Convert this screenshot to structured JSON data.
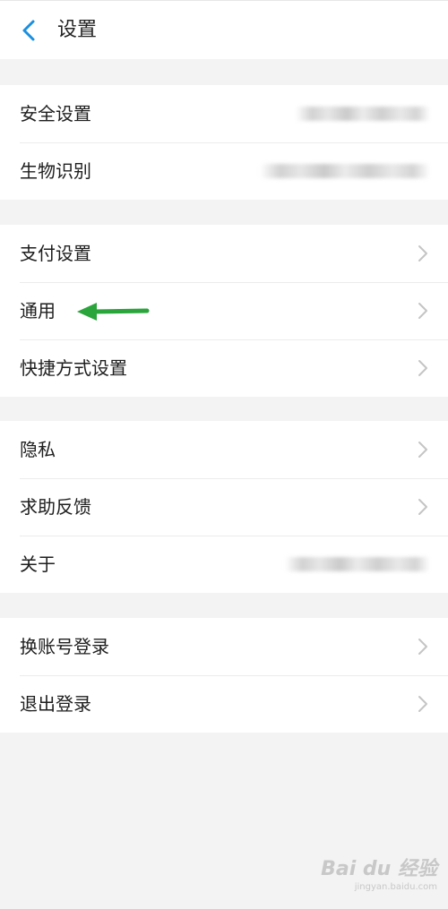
{
  "header": {
    "title": "设置",
    "back_icon": "chevron-left-icon",
    "accent": "#1a8fe0"
  },
  "groups": [
    {
      "items": [
        {
          "label": "安全设置"
        },
        {
          "label": "生物识别"
        }
      ]
    },
    {
      "items": [
        {
          "label": "支付设置"
        },
        {
          "label": "通用"
        },
        {
          "label": "快捷方式设置"
        }
      ]
    },
    {
      "items": [
        {
          "label": "隐私"
        },
        {
          "label": "求助反馈"
        },
        {
          "label": "关于"
        }
      ]
    },
    {
      "items": [
        {
          "label": "换账号登录"
        },
        {
          "label": "退出登录"
        }
      ]
    }
  ],
  "annotation": {
    "arrow_color": "#2aa53b"
  },
  "watermark": {
    "main": "Bai du 经验",
    "sub": "jingyan.baidu.com"
  }
}
